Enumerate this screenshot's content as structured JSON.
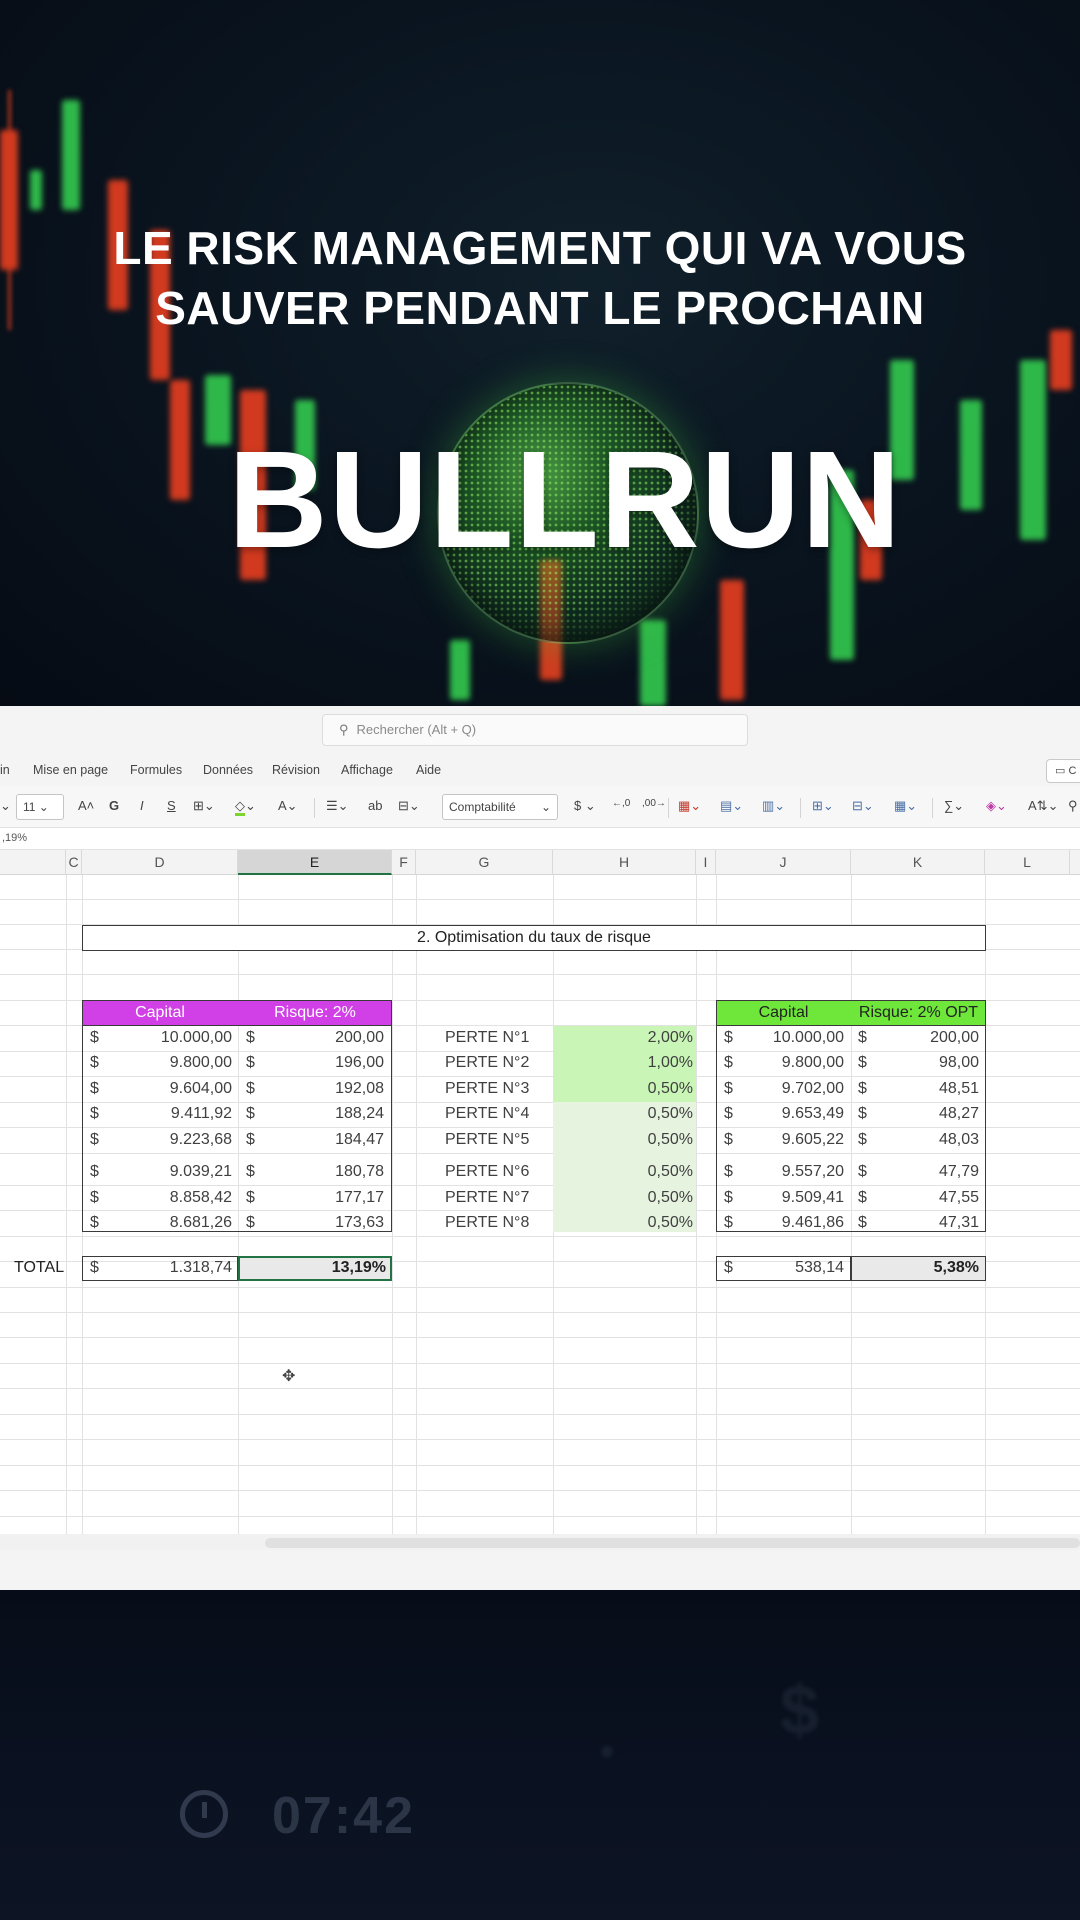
{
  "headline": {
    "line1": "LE RISK MANAGEMENT QUI VA VOUS",
    "line2": "SAUVER PENDANT LE PROCHAIN",
    "big": "BULLRUN"
  },
  "excel": {
    "search_placeholder": "Rechercher (Alt + Q)",
    "menu": [
      "in",
      "Mise en page",
      "Formules",
      "Données",
      "Révision",
      "Affichage",
      "Aide"
    ],
    "comment_label": "C",
    "ribbon": {
      "font_size": "11",
      "bold": "G",
      "italic": "I",
      "underline": "S",
      "number_format": "Comptabilité",
      "currency": "$",
      "sum": "∑"
    },
    "formula_value": ",19%",
    "columns": [
      "C",
      "D",
      "E",
      "F",
      "G",
      "H",
      "I",
      "J",
      "K",
      "L"
    ],
    "selected_column": "E",
    "title": "2. Optimisation du taux de risque",
    "left_table": {
      "headers": [
        "Capital",
        "Risque: 2%"
      ],
      "header_color": "#d040e6",
      "rows": [
        {
          "capital": "10.000,00",
          "risk": "200,00"
        },
        {
          "capital": "9.800,00",
          "risk": "196,00"
        },
        {
          "capital": "9.604,00",
          "risk": "192,08"
        },
        {
          "capital": "9.411,92",
          "risk": "188,24"
        },
        {
          "capital": "9.223,68",
          "risk": "184,47"
        },
        {
          "capital": "9.039,21",
          "risk": "180,78"
        },
        {
          "capital": "8.858,42",
          "risk": "177,17"
        },
        {
          "capital": "8.681,26",
          "risk": "173,63"
        }
      ],
      "total_label": "TOTAL",
      "total_amount": "1.318,74",
      "total_pct": "13,19%"
    },
    "losses": [
      {
        "label": "PERTE N°1",
        "rate": "2,00%"
      },
      {
        "label": "PERTE N°2",
        "rate": "1,00%"
      },
      {
        "label": "PERTE N°3",
        "rate": "0,50%"
      },
      {
        "label": "PERTE N°4",
        "rate": "0,50%"
      },
      {
        "label": "PERTE N°5",
        "rate": "0,50%"
      },
      {
        "label": "PERTE N°6",
        "rate": "0,50%"
      },
      {
        "label": "PERTE N°7",
        "rate": "0,50%"
      },
      {
        "label": "PERTE N°8",
        "rate": "0,50%"
      }
    ],
    "right_table": {
      "headers": [
        "Capital",
        "Risque: 2% OPT"
      ],
      "header_color": "#6fe63a",
      "rows": [
        {
          "capital": "10.000,00",
          "risk": "200,00"
        },
        {
          "capital": "9.800,00",
          "risk": "98,00"
        },
        {
          "capital": "9.702,00",
          "risk": "48,51"
        },
        {
          "capital": "9.653,49",
          "risk": "48,27"
        },
        {
          "capital": "9.605,22",
          "risk": "48,03"
        },
        {
          "capital": "9.557,20",
          "risk": "47,79"
        },
        {
          "capital": "9.509,41",
          "risk": "47,55"
        },
        {
          "capital": "9.461,86",
          "risk": "47,31"
        }
      ],
      "total_amount": "538,14",
      "total_pct": "5,38%"
    },
    "currency_symbol": "$"
  },
  "bottom": {
    "clock_time": "07:42"
  }
}
